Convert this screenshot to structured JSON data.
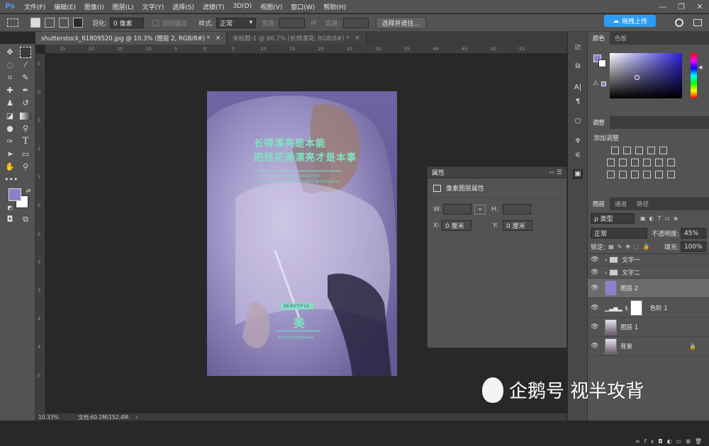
{
  "menubar": {
    "logo": "Ps",
    "items": [
      "文件(F)",
      "编辑(E)",
      "图像(I)",
      "图层(L)",
      "文字(Y)",
      "选择(S)",
      "滤镜(T)",
      "3D(D)",
      "视图(V)",
      "窗口(W)",
      "帮助(H)"
    ],
    "window_controls": [
      "—",
      "❐",
      "✕"
    ]
  },
  "options": {
    "feather_label": "羽化:",
    "feather_value": "0 像素",
    "antialias_label": "消除锯齿",
    "style_label": "样式:",
    "style_value": "正常",
    "width_label": "宽度:",
    "height_label": "高度:",
    "select_mask_button": "选择并遮住...",
    "cloud_button": "拖拽上传"
  },
  "tabs": [
    {
      "label": "shutterstock_61809520.jpg @ 10.3% (图层 2, RGB/8#) *",
      "close": "×"
    },
    {
      "label": "未标题-1 @ 66.7% (长得漂亮, RGB/8#) *",
      "close": "×"
    }
  ],
  "ruler": {
    "top_ticks": [
      "25",
      "20",
      "15",
      "10",
      "5",
      "0",
      "5",
      "10",
      "15",
      "20",
      "25",
      "30",
      "35",
      "40",
      "45",
      "50",
      "55"
    ],
    "left_ticks": [
      "5",
      "0",
      "5",
      "1",
      "1",
      "2",
      "2",
      "3",
      "3",
      "4",
      "4",
      "5"
    ]
  },
  "poster": {
    "headline_1": "长得漂亮是本能",
    "headline_2": "把钱花得漂亮才是本事",
    "sub_1": "IT IS INSTINCT TO BE BEAUTIFUL",
    "sub_2": "IT IS SKILL TO SPEND MONEY BEAUTIFULLY",
    "badge": "BEAUTIFUL",
    "mei": "美",
    "bottom_line": "KOUCAIYOUPIAOLIANGA"
  },
  "status": {
    "zoom": "10.33%",
    "doc_info": "文档:60.2M/152.4M",
    "arrow": "›"
  },
  "properties": {
    "title": "属性",
    "section": "像素图层属性",
    "w_label": "W:",
    "h_label": "H:",
    "x_label": "X:",
    "y_label": "Y:",
    "x_value": "0 厘米",
    "y_value": "0 厘米",
    "link_icon": "link-icon"
  },
  "color_panel": {
    "tabs": [
      "颜色",
      "色板"
    ],
    "foreground": "#8a82c8",
    "background": "#ffffff"
  },
  "adjust_panel": {
    "title": "调整",
    "add_label": "添加调整"
  },
  "layers_panel": {
    "tabs": [
      "图层",
      "通道",
      "路径"
    ],
    "filter_kind": "ρ 类型",
    "blend_mode": "正常",
    "opacity_label": "不透明度:",
    "opacity_value": "45%",
    "lock_label": "锁定:",
    "fill_label": "填充:",
    "fill_value": "100%",
    "layers": [
      {
        "name": "文字一",
        "type": "group"
      },
      {
        "name": "文字二",
        "type": "group"
      },
      {
        "name": "图层 2",
        "type": "color",
        "selected": true
      },
      {
        "name": "色阶 1",
        "type": "adjustment"
      },
      {
        "name": "图层 1",
        "type": "photo"
      },
      {
        "name": "背景",
        "type": "photo",
        "locked": true
      }
    ]
  },
  "watermark": {
    "text": "企鹅号 视半攻背"
  },
  "colors": {
    "brand_blue": "#2d9cf0",
    "poster_overlay": "#7d73b5",
    "accent_green": "#7fe3c2"
  }
}
